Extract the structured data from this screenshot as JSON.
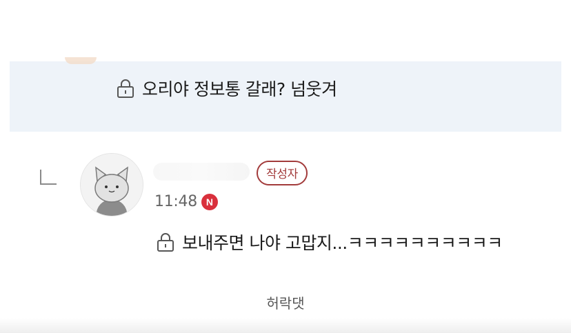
{
  "parent_comment": {
    "text": "오리야 정보통 갈래? 넘웃겨",
    "icon": "lock-icon"
  },
  "reply": {
    "author_badge": "작성자",
    "time": "11:48",
    "new_badge": "N",
    "text": "보내주면 나야 고맙지...ㅋㅋㅋㅋㅋㅋㅋㅋㅋㅋ",
    "icon": "lock-icon",
    "avatar_icon": "cat-avatar-icon"
  },
  "caption": "허락댓",
  "colors": {
    "parent_background": "#eef3f9",
    "author_badge": "#a23a3a",
    "new_badge": "#d9303c"
  }
}
